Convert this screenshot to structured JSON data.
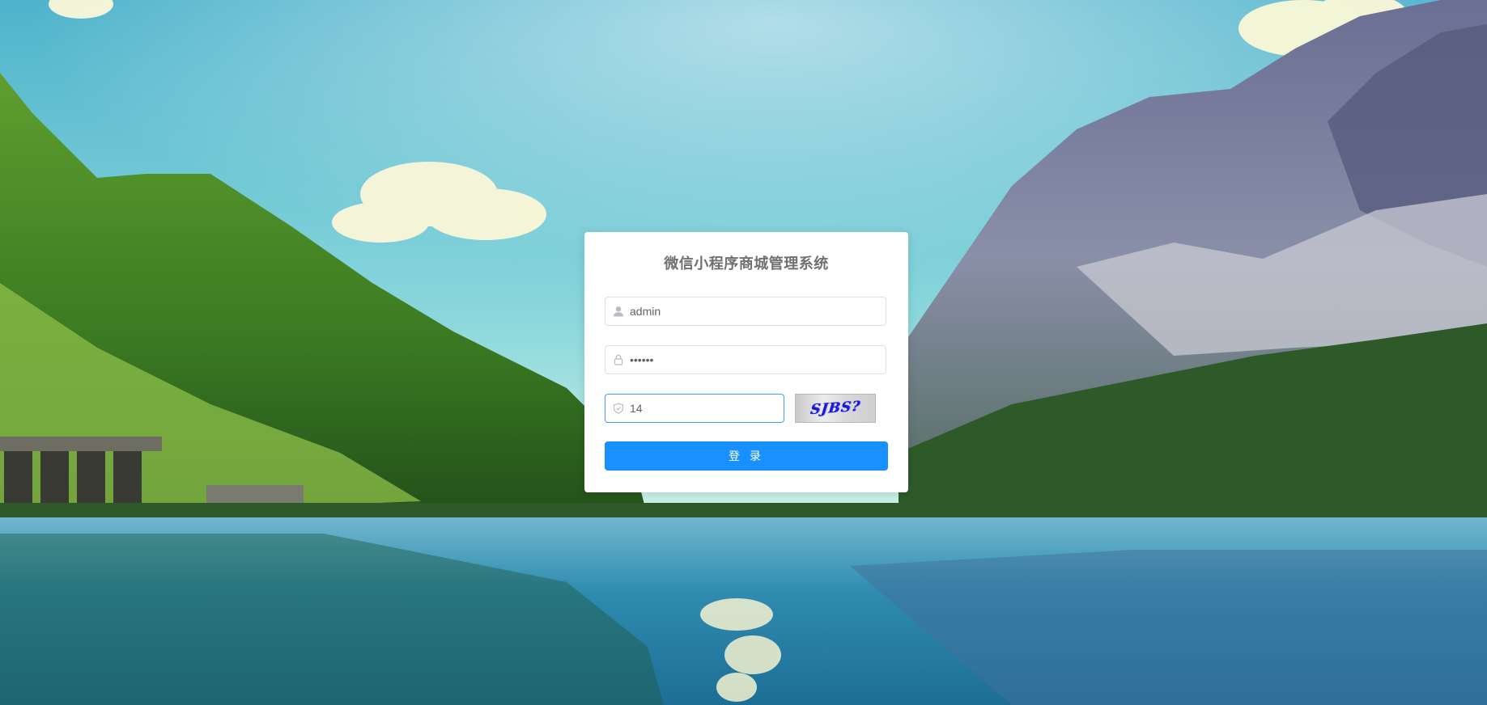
{
  "login": {
    "title": "微信小程序商城管理系统",
    "username": {
      "value": "admin",
      "icon": "user-icon"
    },
    "password": {
      "value": "••••••",
      "icon": "lock-icon"
    },
    "captcha_input": {
      "value": "14",
      "icon": "shield-icon"
    },
    "captcha_image": {
      "text": "SJBS?"
    },
    "submit_label": "登 录"
  },
  "colors": {
    "primary": "#1890ff",
    "focus_border": "#409eff",
    "title_text": "#707070"
  }
}
